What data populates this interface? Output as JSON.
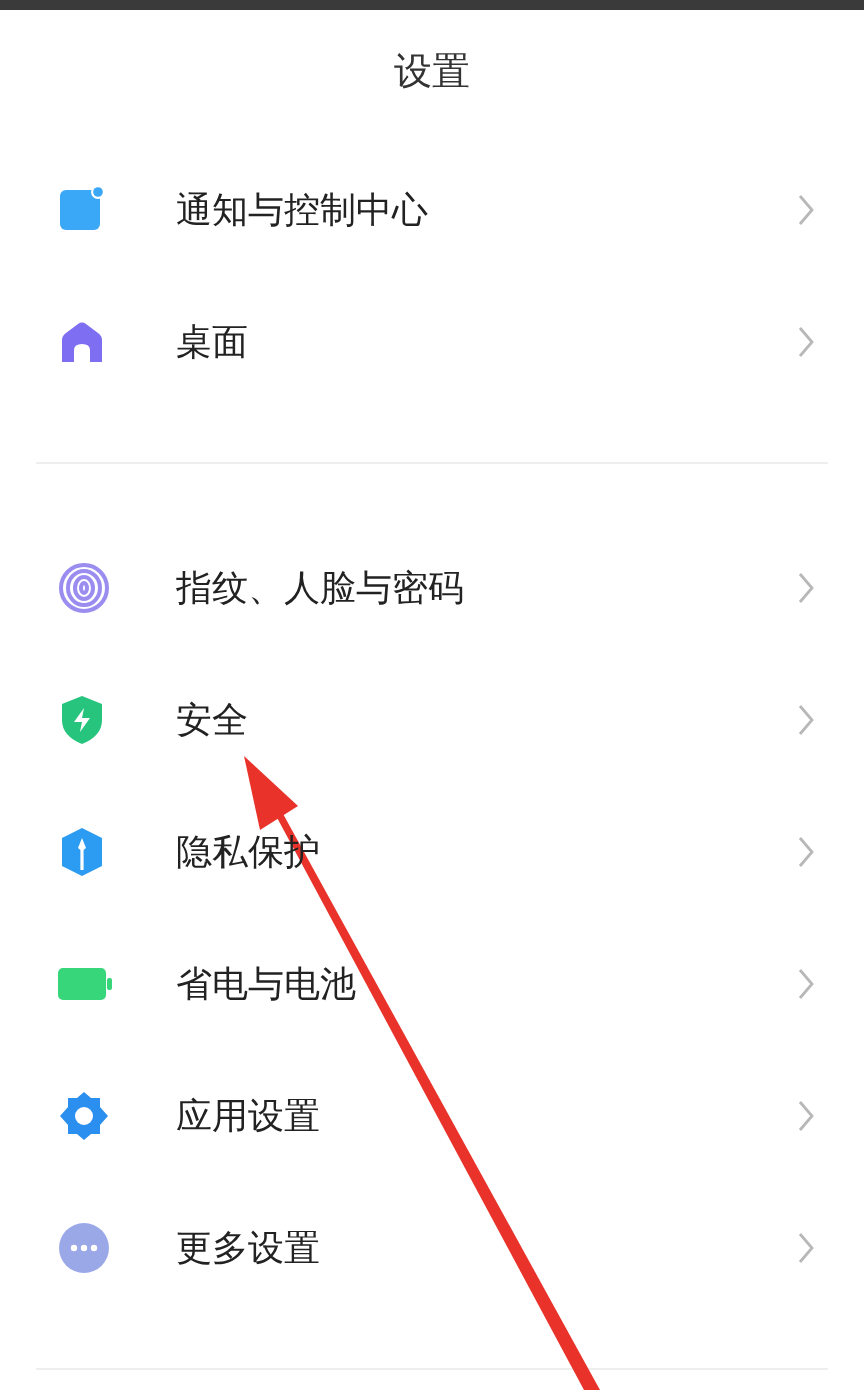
{
  "title": "设置",
  "sections": [
    {
      "items": [
        {
          "label": "通知与控制中心"
        },
        {
          "label": "桌面"
        }
      ]
    },
    {
      "items": [
        {
          "label": "指纹、人脸与密码"
        },
        {
          "label": "安全"
        },
        {
          "label": "隐私保护"
        },
        {
          "label": "省电与电池"
        },
        {
          "label": "应用设置"
        },
        {
          "label": "更多设置"
        }
      ]
    }
  ]
}
